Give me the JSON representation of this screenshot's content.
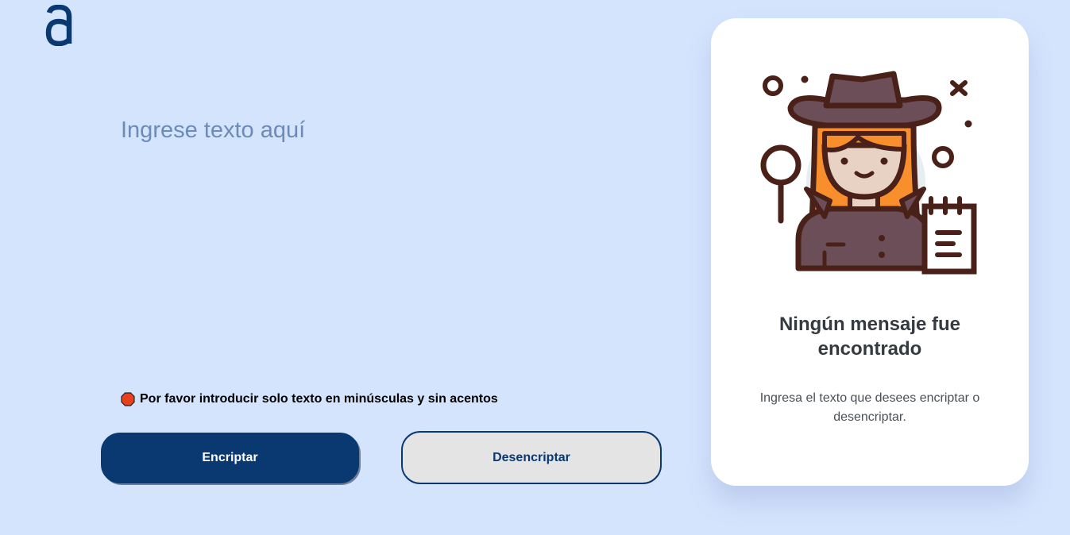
{
  "logo": {
    "icon": "alura-logo-icon",
    "color": "#0a3871"
  },
  "input": {
    "placeholder": "Ingrese texto aquí",
    "value": ""
  },
  "warning": {
    "icon": "stop-sign-icon",
    "text": "Por favor introducir solo texto en minúsculas y sin acentos"
  },
  "buttons": {
    "encrypt_label": "Encriptar",
    "decrypt_label": "Desencriptar"
  },
  "result_panel": {
    "illustration": "detective-girl-illustration",
    "title": "Ningún mensaje fue encontrado",
    "text": "Ingresa el texto que desees encriptar o desencriptar."
  },
  "colors": {
    "background": "#d4e4fd",
    "primary": "#0a3871",
    "secondary_button_bg": "#e4e4e4",
    "card_bg": "#ffffff",
    "placeholder": "#6b8bb8"
  }
}
